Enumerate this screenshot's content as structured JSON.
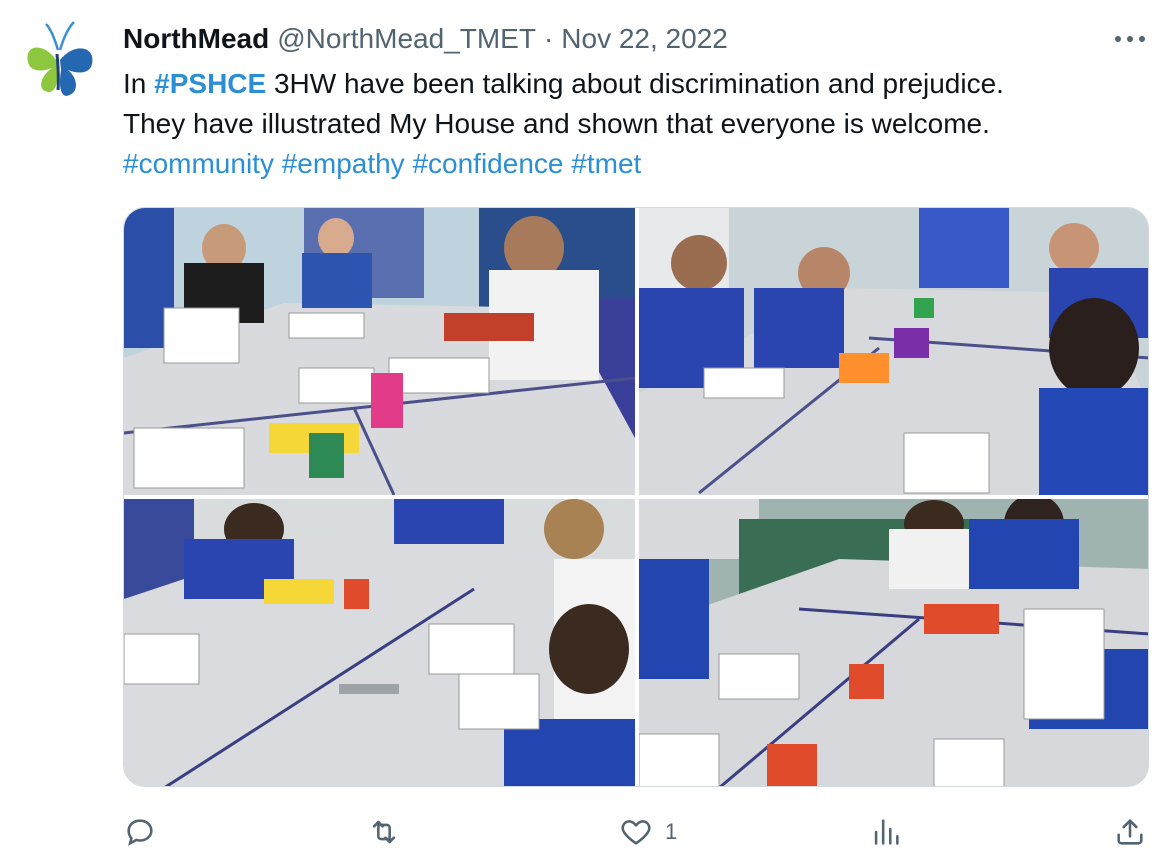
{
  "tweet": {
    "author": {
      "display_name": "NorthMead",
      "handle": "@NorthMead_TMET",
      "separator": "·",
      "date": "Nov 22, 2022",
      "avatar_icon": "butterfly-logo"
    },
    "more_icon": "more-horizontal-icon",
    "text": {
      "line1_prefix": "In ",
      "hashtag_main": "#PSHCE",
      "line1_suffix": " 3HW have been talking about discrimination and prejudice.",
      "line2": "They have illustrated My House and shown that everyone is welcome.",
      "hashtags": [
        "#community",
        "#empathy",
        "#confidence",
        "#tmet"
      ]
    },
    "media": {
      "photos": [
        {
          "name": "classroom-photo-1"
        },
        {
          "name": "classroom-photo-2"
        },
        {
          "name": "classroom-photo-3"
        },
        {
          "name": "classroom-photo-4"
        }
      ]
    },
    "actions": {
      "reply_icon": "reply-icon",
      "retweet_icon": "retweet-icon",
      "like_icon": "heart-icon",
      "like_count": "1",
      "views_icon": "views-icon",
      "share_icon": "share-icon"
    },
    "colors": {
      "hashtag": "#2b8fd6",
      "secondary_text": "#536471",
      "primary_text": "#0f1419",
      "border": "#cfd9de"
    }
  }
}
